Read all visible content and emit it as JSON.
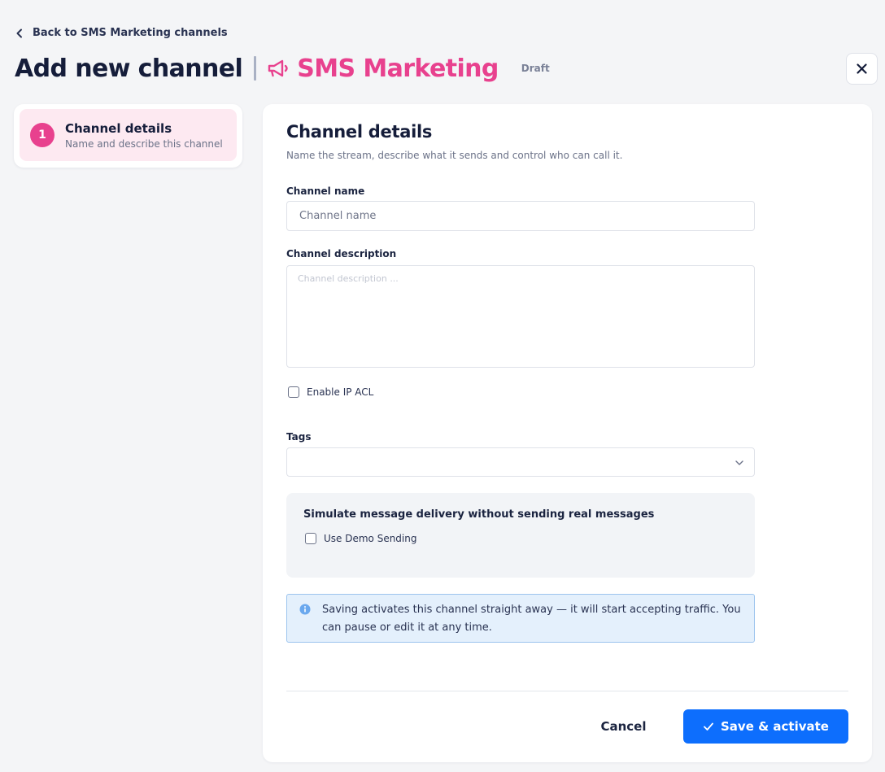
{
  "header": {
    "back_label": "Back to SMS Marketing channels",
    "title": "Add new channel",
    "channel_type": "SMS Marketing",
    "status": "Draft"
  },
  "stepper": {
    "steps": [
      {
        "number": "1",
        "title": "Channel details",
        "subtitle": "Name and describe this channel"
      }
    ]
  },
  "form": {
    "section_title": "Channel details",
    "section_subtitle": "Name the stream, describe what it sends and control who can call it.",
    "name_label": "Channel name",
    "name_value": "",
    "name_placeholder": "Channel name",
    "description_label": "Channel description",
    "description_value": "",
    "description_placeholder": "Channel description ...",
    "ip_acl_label": "Enable IP ACL",
    "ip_acl_checked": false,
    "tags_label": "Tags",
    "tags_value": "",
    "demo_title": "Simulate message delivery without sending real messages",
    "demo_label": "Use Demo Sending",
    "demo_checked": false,
    "info_text": "Saving activates this channel straight away — it will start accepting traffic. You can pause or edit it at any time."
  },
  "footer": {
    "cancel_label": "Cancel",
    "save_label": "Save & activate"
  },
  "colors": {
    "accent_pink": "#e8418e",
    "primary_blue": "#0d6efd",
    "step_bg": "#fde9f1",
    "info_bg": "#e4f0fc",
    "info_border": "#9cc4ee"
  },
  "icons": {
    "back": "chevron-left-icon",
    "channel": "megaphone-icon",
    "close": "close-icon",
    "select": "chevron-down-icon",
    "info": "info-icon",
    "save": "check-icon"
  }
}
